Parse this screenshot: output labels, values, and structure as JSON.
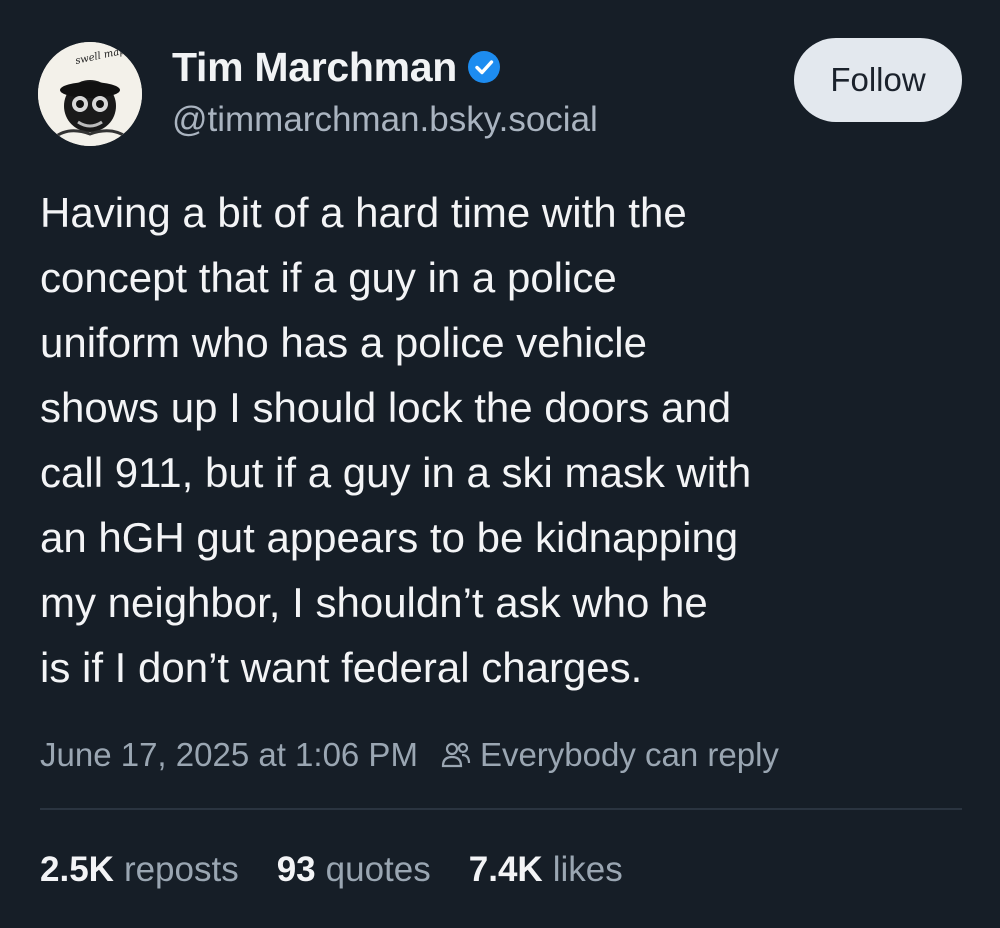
{
  "author": {
    "display_name": "Tim Marchman",
    "handle": "@timmarchman.bsky.social",
    "verified_icon": "verified-badge-icon",
    "avatar_text": "swell maps"
  },
  "follow_button": {
    "label": "Follow"
  },
  "post": {
    "text_lines": [
      "Having a bit of a hard time with the",
      "concept that if a guy in a police",
      "uniform who has a police vehicle",
      "shows up I should lock the doors and",
      "call 911, but if a guy in a ski mask with",
      "an hGH gut appears to be kidnapping",
      "my neighbor, I shouldn’t ask who he",
      "is if I don’t want federal charges."
    ],
    "timestamp": "June 17, 2025 at 1:06 PM",
    "reply_setting": "Everybody can reply",
    "reply_icon": "people-icon"
  },
  "stats": [
    {
      "count": "2.5K",
      "label": "reposts"
    },
    {
      "count": "93",
      "label": "quotes"
    },
    {
      "count": "7.4K",
      "label": "likes"
    }
  ],
  "colors": {
    "background": "#161e27",
    "verified": "#1d8cf0",
    "follow_bg": "#e3e8ee",
    "muted_text": "#9aa6b2"
  }
}
